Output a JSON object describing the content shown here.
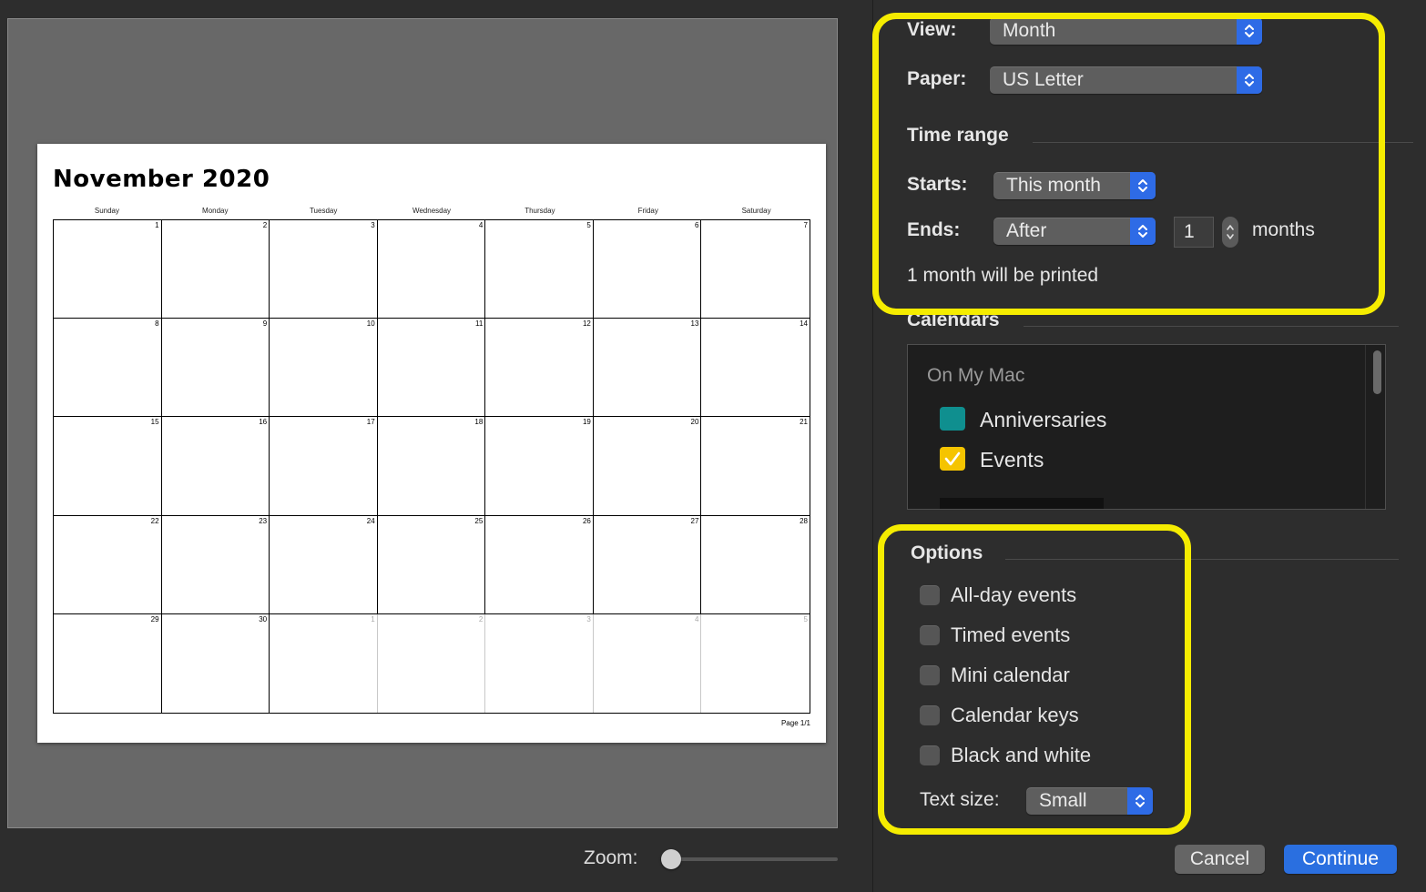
{
  "preview": {
    "month_title": "November 2020",
    "weekdays": [
      "Sunday",
      "Monday",
      "Tuesday",
      "Wednesday",
      "Thursday",
      "Friday",
      "Saturday"
    ],
    "days": [
      "1",
      "2",
      "3",
      "4",
      "5",
      "6",
      "7",
      "8",
      "9",
      "10",
      "11",
      "12",
      "13",
      "14",
      "15",
      "16",
      "17",
      "18",
      "19",
      "20",
      "21",
      "22",
      "23",
      "24",
      "25",
      "26",
      "27",
      "28",
      "29",
      "30",
      "1",
      "2",
      "3",
      "4",
      "5"
    ],
    "page_label": "Page 1/1"
  },
  "zoom": {
    "label": "Zoom:",
    "level": 0.0
  },
  "settings": {
    "view": {
      "label": "View:",
      "value": "Month"
    },
    "paper": {
      "label": "Paper:",
      "value": "US Letter"
    },
    "time_range": {
      "heading": "Time range",
      "starts_label": "Starts:",
      "starts_value": "This month",
      "ends_label": "Ends:",
      "ends_value": "After",
      "count": "1",
      "unit": "months",
      "summary": "1 month will be printed"
    },
    "calendars": {
      "heading": "Calendars",
      "group": "On My Mac",
      "items": [
        {
          "name": "Anniversaries",
          "color": "#0f8f8f",
          "checked": false
        },
        {
          "name": "Events",
          "color": "#f5c400",
          "checked": true
        }
      ]
    },
    "options": {
      "heading": "Options",
      "checkboxes": [
        {
          "label": "All-day events",
          "checked": false
        },
        {
          "label": "Timed events",
          "checked": false
        },
        {
          "label": "Mini calendar",
          "checked": false
        },
        {
          "label": "Calendar keys",
          "checked": false
        },
        {
          "label": "Black and white",
          "checked": false
        }
      ],
      "text_size_label": "Text size:",
      "text_size_value": "Small"
    }
  },
  "buttons": {
    "cancel": "Cancel",
    "continue": "Continue"
  },
  "colors": {
    "highlight": "#f5ec00",
    "accent": "#2a6fe0"
  }
}
